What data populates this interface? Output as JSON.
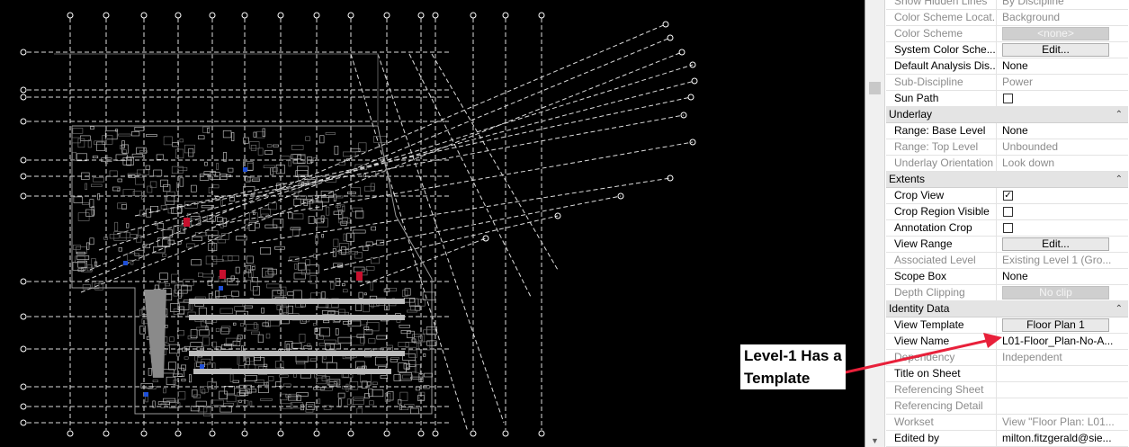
{
  "properties": {
    "rows": [
      {
        "type": "row",
        "label": "Show Hidden Lines",
        "value": "By Discipline",
        "dim": true
      },
      {
        "type": "row",
        "label": "Color Scheme Locat...",
        "value": "Background",
        "dim": true
      },
      {
        "type": "row",
        "label": "Color Scheme",
        "value": "<none>",
        "dim": true,
        "control": "button-disabled"
      },
      {
        "type": "row",
        "label": "System Color Sche...",
        "value": "Edit...",
        "control": "button"
      },
      {
        "type": "row",
        "label": "Default Analysis Dis...",
        "value": "None"
      },
      {
        "type": "row",
        "label": "Sub-Discipline",
        "value": "Power",
        "dim": true
      },
      {
        "type": "row",
        "label": "Sun Path",
        "value": "",
        "control": "checkbox",
        "checked": false
      },
      {
        "type": "group",
        "label": "Underlay"
      },
      {
        "type": "row",
        "label": "Range: Base Level",
        "value": "None"
      },
      {
        "type": "row",
        "label": "Range: Top Level",
        "value": "Unbounded",
        "dim": true
      },
      {
        "type": "row",
        "label": "Underlay Orientation",
        "value": "Look down",
        "dim": true
      },
      {
        "type": "group",
        "label": "Extents"
      },
      {
        "type": "row",
        "label": "Crop View",
        "value": "",
        "control": "checkbox",
        "checked": true
      },
      {
        "type": "row",
        "label": "Crop Region Visible",
        "value": "",
        "control": "checkbox",
        "checked": false
      },
      {
        "type": "row",
        "label": "Annotation Crop",
        "value": "",
        "control": "checkbox",
        "checked": false
      },
      {
        "type": "row",
        "label": "View Range",
        "value": "Edit...",
        "control": "button"
      },
      {
        "type": "row",
        "label": "Associated Level",
        "value": "Existing Level 1 (Gro...",
        "dim": true
      },
      {
        "type": "row",
        "label": "Scope Box",
        "value": "None"
      },
      {
        "type": "row",
        "label": "Depth Clipping",
        "value": "No clip",
        "dim": true,
        "control": "button-disabled"
      },
      {
        "type": "group",
        "label": "Identity Data"
      },
      {
        "type": "row",
        "label": "View Template",
        "value": "Floor Plan 1",
        "control": "button"
      },
      {
        "type": "row",
        "label": "View Name",
        "value": "L01-Floor_Plan-No-A..."
      },
      {
        "type": "row",
        "label": "Dependency",
        "value": "Independent",
        "dim": true
      },
      {
        "type": "row",
        "label": "Title on Sheet",
        "value": ""
      },
      {
        "type": "row",
        "label": "Referencing Sheet",
        "value": "",
        "dim": true
      },
      {
        "type": "row",
        "label": "Referencing Detail",
        "value": "",
        "dim": true
      },
      {
        "type": "row",
        "label": "Workset",
        "value": "View \"Floor Plan: L01...",
        "dim": true
      },
      {
        "type": "row",
        "label": "Edited by",
        "value": "milton.fitzgerald@sie..."
      }
    ]
  },
  "annotation": {
    "line1": "Level-1 Has a",
    "line2": "Template",
    "color": "#e8203a"
  },
  "icons": {
    "collapse": "chevron-up-double-icon",
    "check": "checkmark-icon",
    "scroll_down": "scroll-down-arrow-icon"
  },
  "glyphs": {
    "collapse": "⌃",
    "check": "✓",
    "scroll_down": "▼"
  },
  "colors": {
    "canvas": "#000000",
    "group_header": "#e4e4e4",
    "tag_red": "#c8102e"
  }
}
